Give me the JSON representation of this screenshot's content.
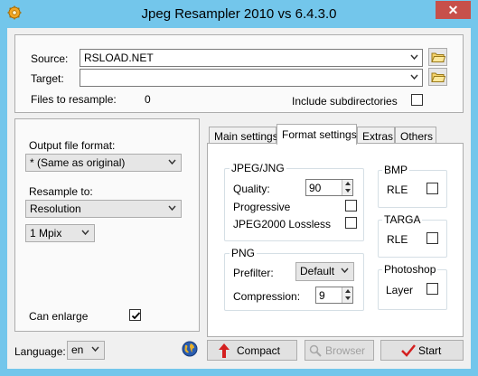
{
  "window": {
    "title": "Jpeg Resampler 2010 vs 6.4.3.0",
    "close_glyph": "✕"
  },
  "paths": {
    "source_label": "Source:",
    "source_value": "RSLOAD.NET",
    "target_label": "Target:",
    "target_value": "",
    "files_label": "Files to resample:",
    "files_count": "0",
    "include_subdirs_label": "Include subdirectories",
    "include_subdirs_checked": false
  },
  "left": {
    "output_format_label": "Output file format:",
    "output_format_value": "* (Same as original)",
    "resample_to_label": "Resample to:",
    "resample_to_value": "Resolution",
    "size_value": "1 Mpix",
    "can_enlarge_label": "Can enlarge",
    "can_enlarge_checked": true
  },
  "tabs": [
    {
      "label": "Main settings",
      "active": false
    },
    {
      "label": "Format settings",
      "active": true
    },
    {
      "label": "Extras",
      "active": false
    },
    {
      "label": "Others",
      "active": false
    }
  ],
  "format": {
    "jpeg": {
      "title": "JPEG/JNG",
      "quality_label": "Quality:",
      "quality_value": "90",
      "progressive_label": "Progressive",
      "jpeg2000_label": "JPEG2000 Lossless"
    },
    "png": {
      "title": "PNG",
      "prefilter_label": "Prefilter:",
      "prefilter_value": "Default",
      "compression_label": "Compression:",
      "compression_value": "9"
    },
    "bmp": {
      "title": "BMP",
      "rle_label": "RLE"
    },
    "targa": {
      "title": "TARGA",
      "rle_label": "RLE"
    },
    "photoshop": {
      "title": "Photoshop",
      "layer_label": "Layer"
    }
  },
  "bottom": {
    "language_label": "Language:",
    "language_value": "en",
    "compact_label": "Compact",
    "browser_label": "Browser",
    "start_label": "Start"
  },
  "colors": {
    "frame": "#73c6eb",
    "close": "#c7504a",
    "compact_arrow": "#d42020",
    "start_check": "#d42020"
  },
  "icons": {
    "app": "gear-icon",
    "folder": "folder-icon",
    "globe": "globe-icon",
    "compact": "red-up-arrow-icon",
    "browser": "magnifier-icon",
    "start": "red-checkmark-icon"
  }
}
